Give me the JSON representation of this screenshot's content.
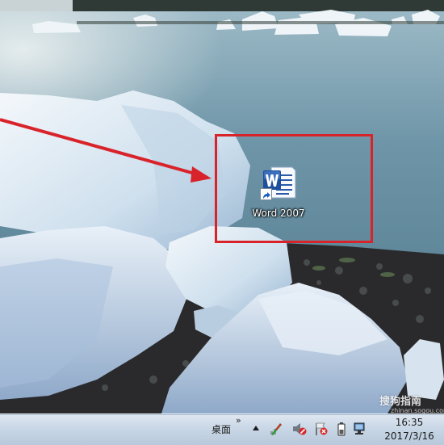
{
  "desktop": {
    "icons": [
      {
        "label": "Word 2007",
        "icon": "word-2007-shortcut-icon"
      }
    ]
  },
  "annotation": {
    "color": "#d9232a"
  },
  "taskbar": {
    "toolbar_label": "桌面",
    "toolbar_chevron": "»",
    "tray": {
      "icons": [
        "tray-expand-icon",
        "network-icon",
        "volume-muted-icon",
        "action-center-flag-icon",
        "battery-icon",
        "display-icon"
      ],
      "time": "16:35",
      "date": "2017/3/16"
    }
  },
  "watermark": {
    "text": "搜狗指南",
    "subtext": "zhinan.sogou.com"
  }
}
